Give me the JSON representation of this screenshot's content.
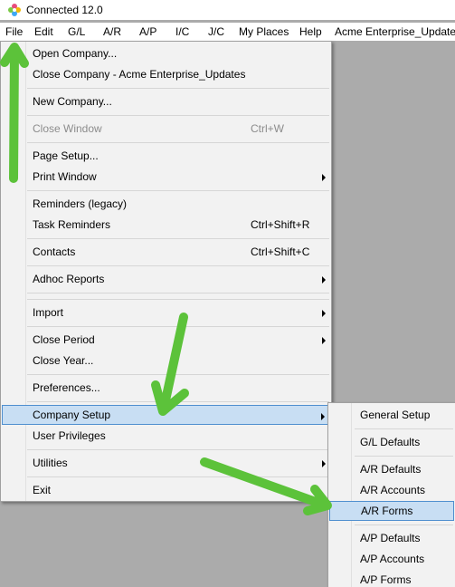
{
  "window": {
    "title": "Connected 12.0"
  },
  "menubar": {
    "items": [
      "File",
      "Edit",
      "G/L",
      "A/R",
      "A/P",
      "I/C",
      "J/C",
      "My Places",
      "Help",
      "Acme Enterprise_Updates"
    ]
  },
  "file_menu": {
    "items": [
      {
        "label": "Open Company..."
      },
      {
        "label": "Close Company - Acme Enterprise_Updates"
      },
      {
        "label": "New Company..."
      },
      {
        "label": "Close Window",
        "shortcut": "Ctrl+W",
        "disabled": true
      },
      {
        "label": "Page Setup..."
      },
      {
        "label": "Print Window",
        "submenu": true
      },
      {
        "label": "Reminders (legacy)"
      },
      {
        "label": "Task Reminders",
        "shortcut": "Ctrl+Shift+R"
      },
      {
        "label": "Contacts",
        "shortcut": "Ctrl+Shift+C"
      },
      {
        "label": "Adhoc Reports",
        "submenu": true
      },
      {
        "label": "Import",
        "submenu": true
      },
      {
        "label": "Close Period",
        "submenu": true
      },
      {
        "label": "Close Year..."
      },
      {
        "label": "Preferences..."
      },
      {
        "label": "Company Setup",
        "submenu": true,
        "highlighted": true
      },
      {
        "label": "User Privileges"
      },
      {
        "label": "Utilities",
        "submenu": true
      },
      {
        "label": "Exit"
      }
    ]
  },
  "company_setup_submenu": {
    "items": [
      {
        "label": "General Setup"
      },
      {
        "label": "G/L Defaults"
      },
      {
        "label": "A/R Defaults"
      },
      {
        "label": "A/R Accounts"
      },
      {
        "label": "A/R Forms",
        "highlighted": true
      },
      {
        "label": "A/P Defaults"
      },
      {
        "label": "A/P Accounts"
      },
      {
        "label": "A/P Forms"
      }
    ]
  },
  "colors": {
    "menu_background": "#f2f2f2",
    "highlight": "#c8def3",
    "highlight_border": "#4f8fcf",
    "annotation_arrow": "#5cc23a",
    "workspace": "#ababab"
  }
}
